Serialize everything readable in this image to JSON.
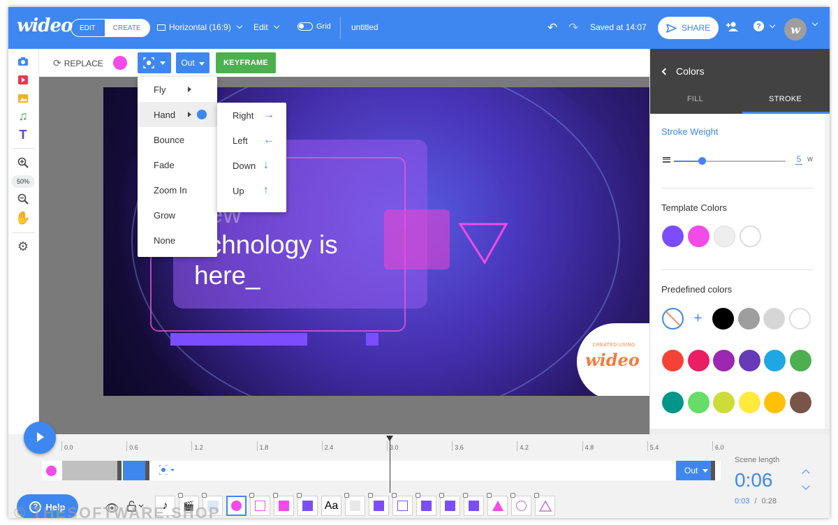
{
  "app": {
    "logo": "wideo",
    "title": "untitled"
  },
  "topbar": {
    "mode_edit": "EDIT",
    "mode_create": "CREATE",
    "aspect": "Horizontal (16:9)",
    "edit_menu": "Edit",
    "grid_label": "Grid",
    "saved": "Saved at 14:07",
    "share": "SHARE",
    "avatar_letter": "w"
  },
  "toolbar": {
    "replace": "REPLACE",
    "out": "Out",
    "keyframe": "KEYFRAME",
    "zoom": "50%"
  },
  "scene": {
    "line1": "new",
    "line2": "echnology is",
    "line3": "here_",
    "badge_small": "CREATED USING",
    "badge_logo": "wideo"
  },
  "animation_menu": {
    "items": [
      "Fly",
      "Hand",
      "Bounce",
      "Fade",
      "Zoom In",
      "Grow",
      "None"
    ],
    "submenu": [
      {
        "label": "Right",
        "arrow": "→"
      },
      {
        "label": "Left",
        "arrow": "←"
      },
      {
        "label": "Down",
        "arrow": "↓"
      },
      {
        "label": "Up",
        "arrow": "↑"
      }
    ]
  },
  "panel": {
    "title": "Colors",
    "tab_fill": "FILL",
    "tab_stroke": "STROKE",
    "stroke_weight_label": "Stroke Weight",
    "stroke_weight": "5",
    "stroke_unit": "w",
    "template_colors_label": "Template Colors",
    "predefined_label": "Predefined colors",
    "template_colors": [
      "#7c4dff",
      "#f24be8",
      "#eeeeee",
      "#ffffff"
    ],
    "predefined_row1": [
      "#000000",
      "#9e9e9e",
      "#d6d6d6",
      "#ffffff"
    ],
    "predefined_row2": [
      "#f44336",
      "#e91e63",
      "#9c27b0",
      "#673ab7",
      "#1da8e3",
      "#4caf50"
    ],
    "predefined_row3": [
      "#009688",
      "#66dd66",
      "#cddc39",
      "#ffeb3b",
      "#ffc107",
      "#795548"
    ]
  },
  "timeline": {
    "ticks": [
      "0.0",
      "0.6",
      "1.2",
      "1.8",
      "2.4",
      "3.0",
      "3.6",
      "4.2",
      "4.8",
      "5.4",
      "6.0"
    ],
    "out": "Out",
    "scene_length_label": "Scene length",
    "scene_length": "0:06",
    "current": "0:03",
    "total": "0:28",
    "separator": "/",
    "help": "Help",
    "watermark": "© THESOFTWARE.SHOP"
  },
  "colors": {
    "accent": "#3f87f0",
    "keyframe": "#4caf50"
  }
}
